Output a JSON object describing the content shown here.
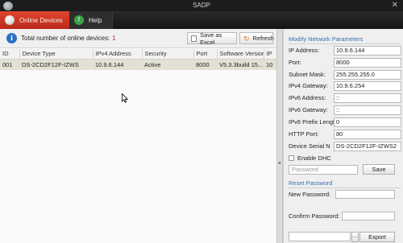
{
  "window": {
    "title": "SADP",
    "close_glyph": "✕"
  },
  "tabs": [
    {
      "label": "Online Devices",
      "icon": "globe-icon",
      "active": true
    },
    {
      "label": "Help",
      "icon": "help-icon",
      "active": false
    }
  ],
  "help_glyph": "!",
  "toolbar": {
    "info_glyph": "i",
    "count_label": "Total number of online devices:",
    "count_value": "1",
    "save_excel_label": "Save as Excel",
    "refresh_label": "Refresh",
    "refresh_glyph": "↻"
  },
  "table": {
    "columns": [
      "ID",
      "Device Type",
      "IPv4 Address",
      "Security",
      "Port",
      "Software Version",
      "IP"
    ],
    "rows": [
      [
        "001",
        "DS-2CD2F12F-IZWS",
        "10.9.6.144",
        "Active",
        "8000",
        "V5.3.3build 15...",
        "10"
      ]
    ]
  },
  "divider_glyph": "◂",
  "panel": {
    "title": "Modify Network Parameters",
    "fields": [
      {
        "label": "IP Address:",
        "value": "10.9.6.144"
      },
      {
        "label": "Port:",
        "value": "8000"
      },
      {
        "label": "Subnet Mask:",
        "value": "255.255.255.0"
      },
      {
        "label": "IPv4 Gateway:",
        "value": "10.9.6.254"
      },
      {
        "label": "IPv6 Address:",
        "value": "::"
      },
      {
        "label": "IPv6 Gateway:",
        "value": "::"
      },
      {
        "label": "IPv6 Prefix Lengt",
        "value": "0"
      },
      {
        "label": "HTTP Port:",
        "value": "80"
      },
      {
        "label": "Device Serial N",
        "value": "DS-2CD2F12F-IZWS2"
      }
    ],
    "enable_dhcp_label": "Enable DHC",
    "password_placeholder": "Password",
    "save_label": "Save",
    "reset_title": "Reset Password",
    "new_password_label": "New Password:",
    "confirm_password_label": "Confirm Password:",
    "browse_label": "...",
    "export_label": "Export"
  },
  "colors": {
    "accent_red": "#c8301f",
    "section_blue": "#3a6fb0",
    "count_red": "#d02020",
    "selected_row": "#e3e1d3"
  }
}
